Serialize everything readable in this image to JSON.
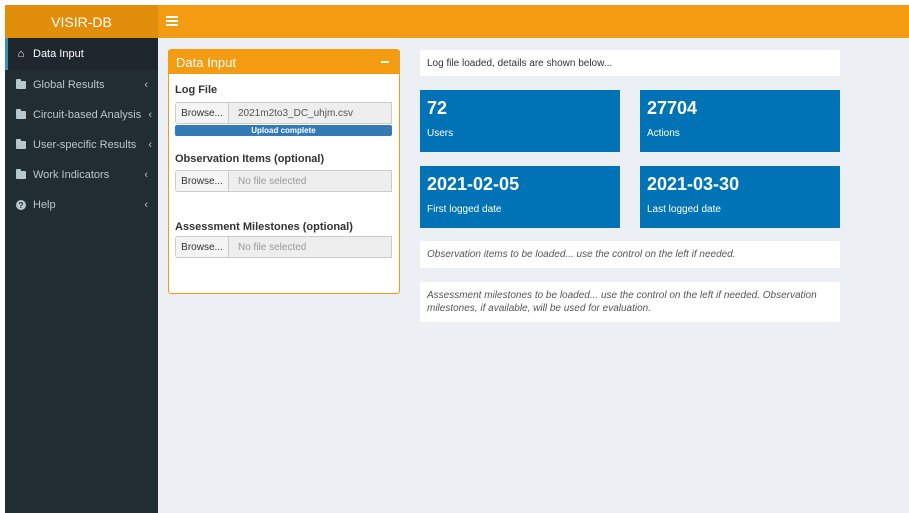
{
  "app": {
    "title": "VISIR-DB"
  },
  "sidebar": {
    "items": [
      {
        "label": "Data Input",
        "icon": "home-icon",
        "active": true
      },
      {
        "label": "Global Results",
        "icon": "folder-icon"
      },
      {
        "label": "Circuit-based Analysis",
        "icon": "folder-icon"
      },
      {
        "label": "User-specific Results",
        "icon": "folder-icon"
      },
      {
        "label": "Work Indicators",
        "icon": "folder-icon"
      },
      {
        "label": "Help",
        "icon": "question-circle-icon"
      }
    ]
  },
  "input_box": {
    "title": "Data Input",
    "log_file": {
      "label": "Log File",
      "browse_label": "Browse...",
      "file_name": "2021m2to3_DC_uhjm.csv",
      "progress_text": "Upload complete",
      "progress": 1.0
    },
    "observation": {
      "label": "Observation Items (optional)",
      "browse_label": "Browse...",
      "file_name": "No file selected"
    },
    "milestones": {
      "label": "Assessment Milestones (optional)",
      "browse_label": "Browse...",
      "file_name": "No file selected"
    }
  },
  "status": {
    "log_message": "Log file loaded, details are shown below...",
    "observation_message": "Observation items to be loaded... use the control on the left if needed.",
    "milestones_message": "Assessment milestones to be loaded... use the control on the left if needed. Observation milestones, if available, will be used for evaluation."
  },
  "stats": {
    "users": {
      "value": "72",
      "label": "Users"
    },
    "actions": {
      "value": "27704",
      "label": "Actions"
    },
    "first_date": {
      "value": "2021-02-05",
      "label": "First logged date"
    },
    "last_date": {
      "value": "2021-03-30",
      "label": "Last logged date"
    }
  },
  "colors": {
    "header": "#f39c12",
    "logo": "#e08e0b",
    "sidebar": "#222d32",
    "value_box": "#0073b7",
    "progress": "#337ab7"
  }
}
